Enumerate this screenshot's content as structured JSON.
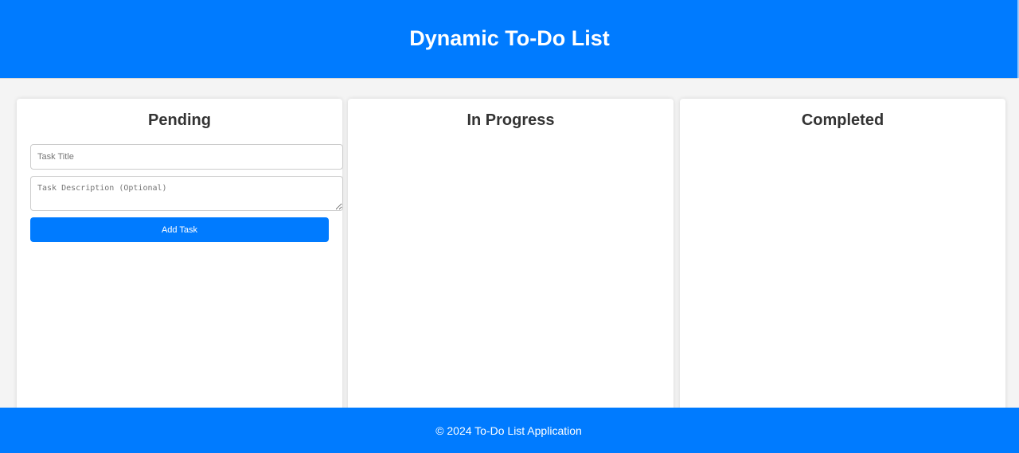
{
  "header": {
    "title": "Dynamic To-Do List"
  },
  "columns": [
    {
      "title": "Pending"
    },
    {
      "title": "In Progress"
    },
    {
      "title": "Completed"
    }
  ],
  "form": {
    "title_placeholder": "Task Title",
    "title_value": "",
    "description_placeholder": "Task Description (Optional)",
    "description_value": "",
    "add_button_label": "Add Task"
  },
  "footer": {
    "text": "© 2024 To-Do List Application"
  },
  "colors": {
    "primary": "#007bff",
    "background": "#f4f4f4",
    "card": "#ffffff",
    "heading_text": "#333333"
  }
}
